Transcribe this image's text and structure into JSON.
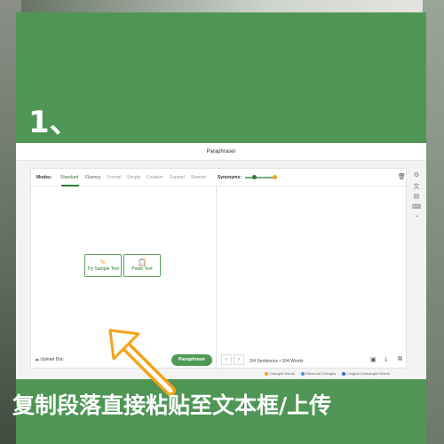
{
  "step": {
    "number": "1、"
  },
  "app": {
    "title": "Paraphraser",
    "modes_label": "Modes:",
    "modes": [
      "Standard",
      "Fluency",
      "Formal",
      "Simple",
      "Creative",
      "Expand",
      "Shorten"
    ],
    "synonyms_label": "Synonyms:",
    "sample_button": "Try Sample Text",
    "paste_button": "Paste Text",
    "upload_label": "Upload Doc",
    "paraphrase_button": "Paraphrase",
    "stats": "2/4 Sentences • 104 Words",
    "legend": [
      "Changed Words",
      "Structural Changes",
      "Longest Unchanged Words"
    ],
    "legend_colors": [
      "#f2a31b",
      "#4a90d9",
      "#2a6cc4"
    ]
  },
  "caption": "复制段落直接粘贴至文本框/上传",
  "colors": {
    "card": "#4f9655",
    "accent": "#2e7d32",
    "arrow": "#f2a31b"
  },
  "icons": [
    "trash-icon",
    "upload-icon",
    "sample-icon",
    "paste-icon",
    "download-icon",
    "copy-icon",
    "settings-icon"
  ]
}
